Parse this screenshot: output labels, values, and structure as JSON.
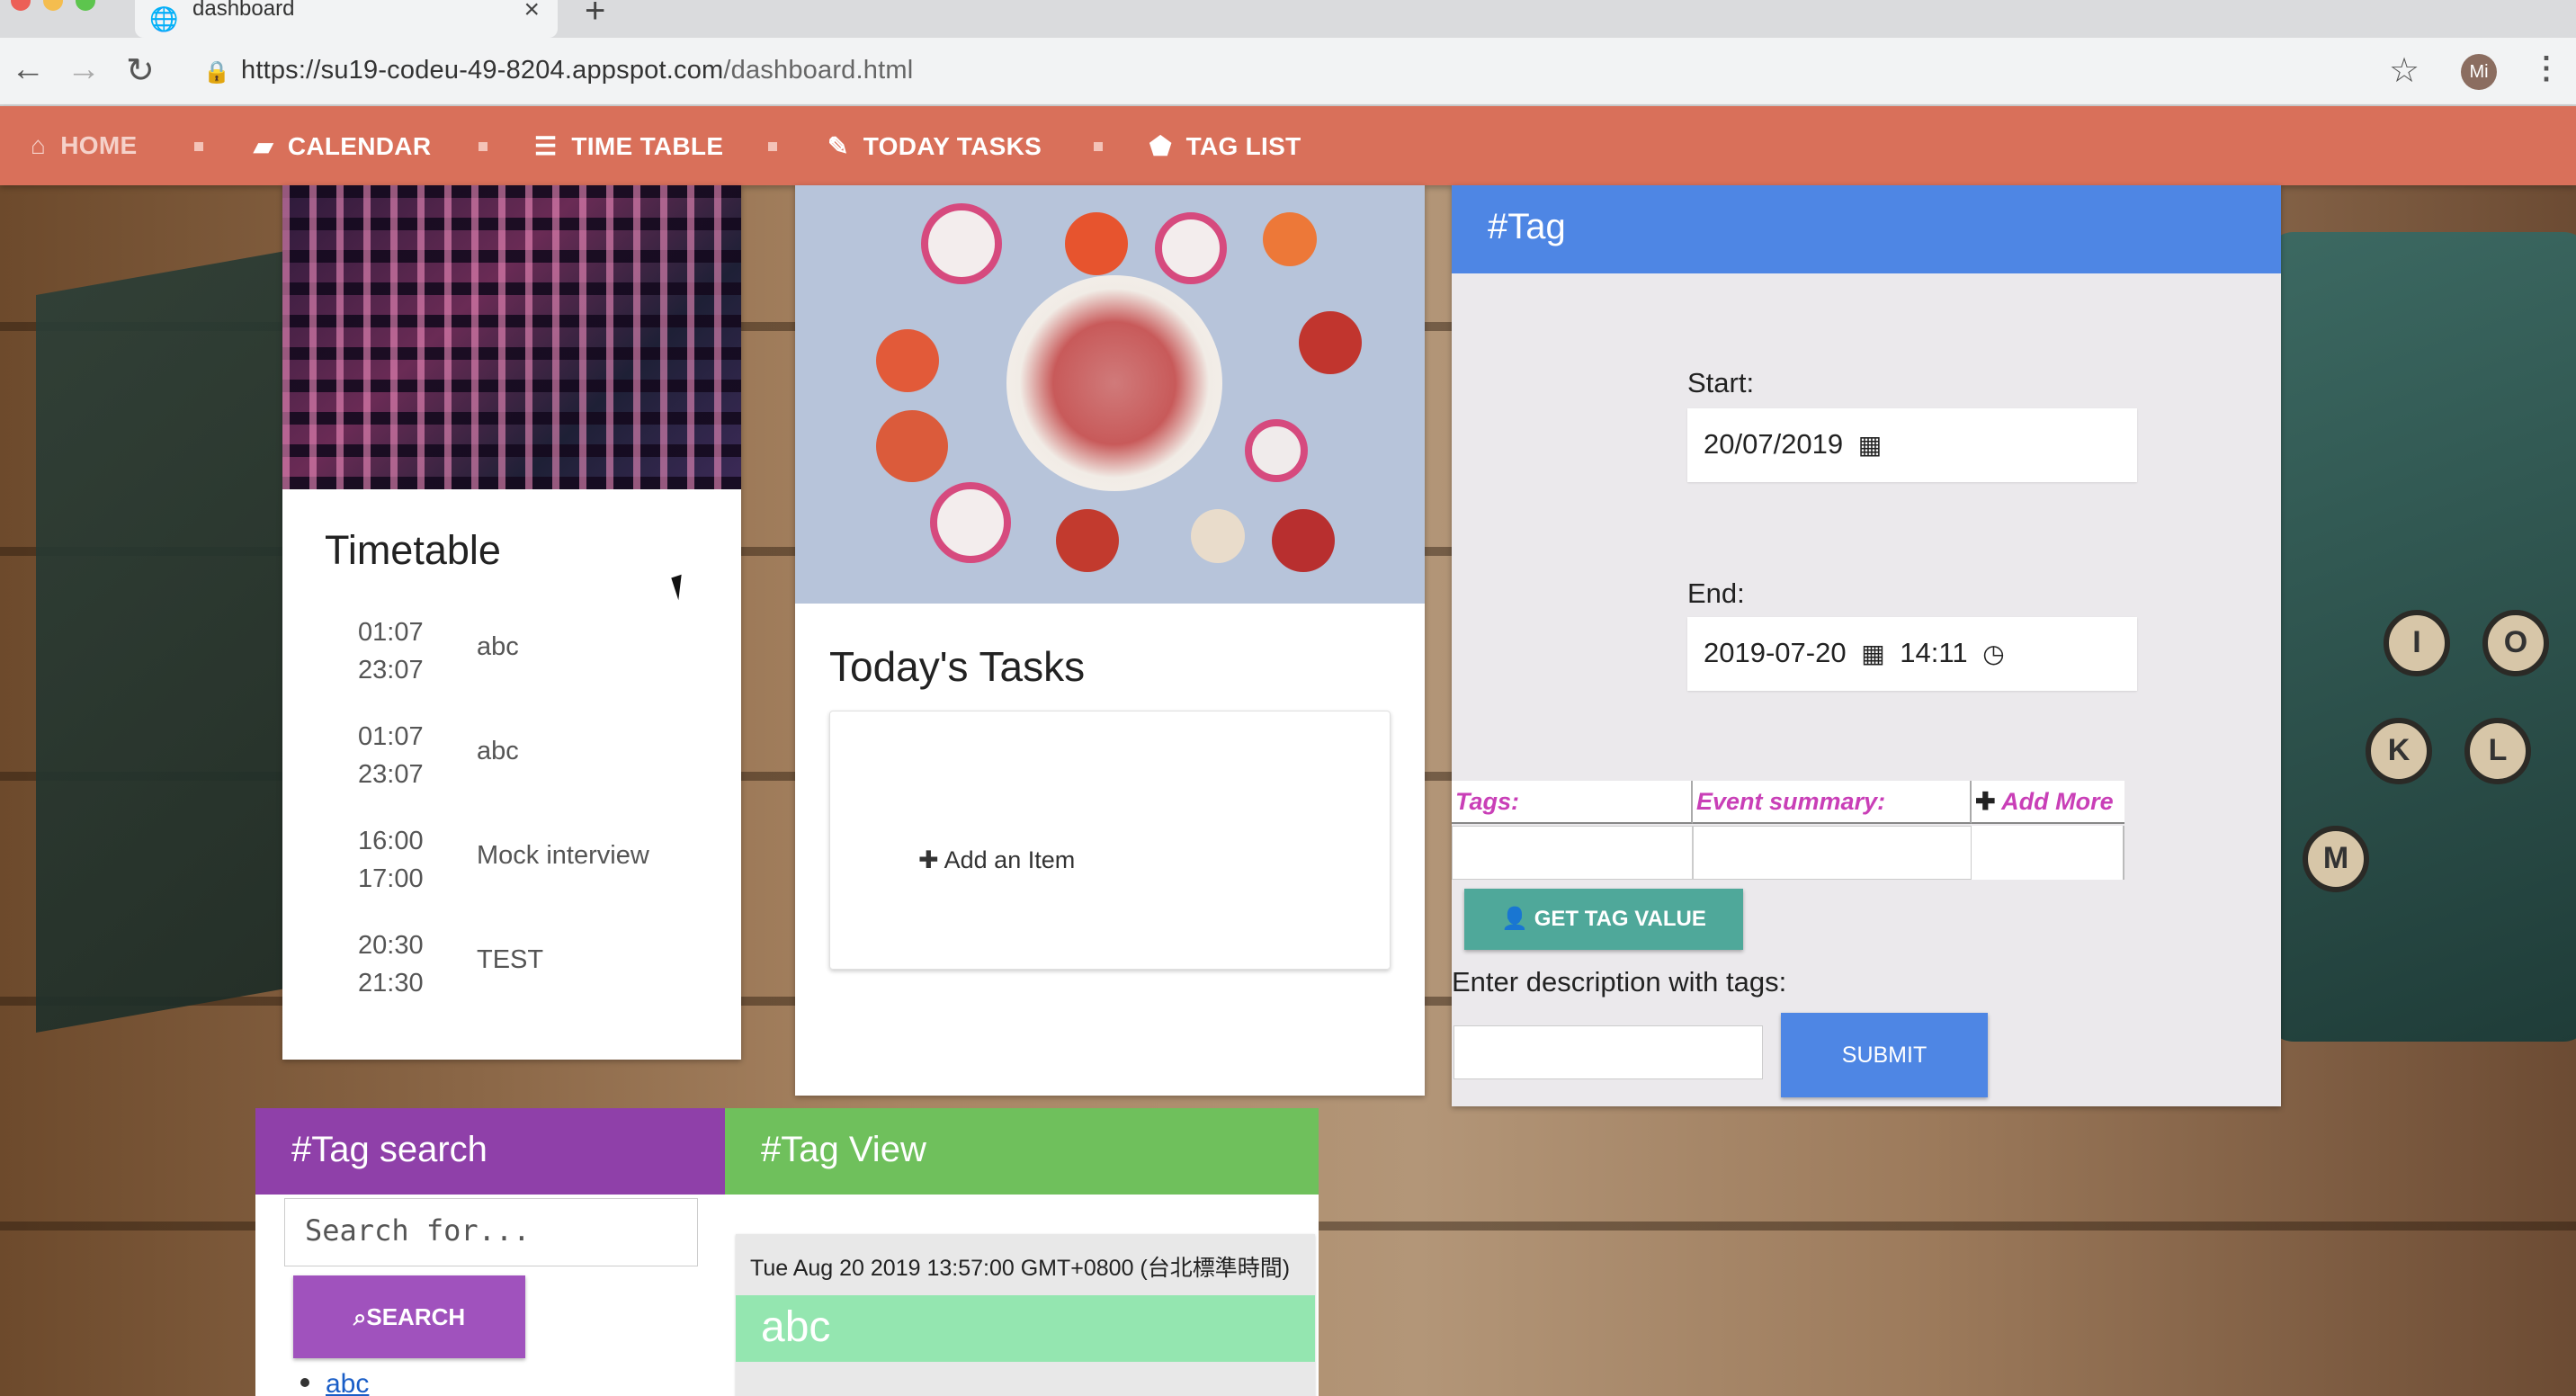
{
  "browser": {
    "tab_title": "dashboard",
    "tab_close": "×",
    "new_tab": "+",
    "url_domain": "https://su19-codeu-49-8204.appspot.com",
    "url_path": "/dashboard.html",
    "avatar_initials": "Mi",
    "icons": {
      "back": "back-arrow-icon",
      "forward": "forward-arrow-icon",
      "reload": "reload-icon",
      "lock": "lock-icon",
      "star": "star-icon",
      "menu": "kebab-menu-icon"
    }
  },
  "nav": {
    "items": [
      {
        "label": "HOME",
        "icon": "home-icon"
      },
      {
        "label": "CALENDAR",
        "icon": "book-icon"
      },
      {
        "label": "TIME TABLE",
        "icon": "list-icon"
      },
      {
        "label": "TODAY TASKS",
        "icon": "pencil-icon"
      },
      {
        "label": "TAG LIST",
        "icon": "tag-icon"
      }
    ]
  },
  "timetable": {
    "title": "Timetable",
    "rows": [
      {
        "start": "01:07",
        "end": "23:07",
        "name": "abc"
      },
      {
        "start": "01:07",
        "end": "23:07",
        "name": "abc"
      },
      {
        "start": "16:00",
        "end": "17:00",
        "name": "Mock interview"
      },
      {
        "start": "20:30",
        "end": "21:30",
        "name": "TEST"
      }
    ]
  },
  "tasks": {
    "title": "Today's Tasks",
    "add_label": "Add an Item"
  },
  "tag": {
    "header": "#Tag",
    "start_label": "Start:",
    "start_value": "20/07/2019",
    "end_label": "End:",
    "end_date": "2019-07-20",
    "end_time": "14:11",
    "col_tags": "Tags:",
    "col_summary": "Event summary:",
    "add_more": "Add More",
    "get_value_btn": "GET TAG VALUE",
    "desc_label": "Enter description with tags:",
    "submit_btn": "SUBMIT"
  },
  "tag_search": {
    "header": "#Tag search",
    "placeholder": "Search for...",
    "search_btn": "SEARCH",
    "results": [
      "abc"
    ]
  },
  "tag_view": {
    "header": "#Tag View",
    "date": "Tue Aug 20 2019 13:57:00 GMT+0800 (台北標準時間)",
    "tag": "abc"
  },
  "colors": {
    "nav": "#d9705a",
    "tag_header": "#4e86e4",
    "tag_search_header": "#8f40a9",
    "tag_view_header": "#6fc05c",
    "teal_button": "#4fa89a",
    "pink_label": "#c93fb7"
  }
}
